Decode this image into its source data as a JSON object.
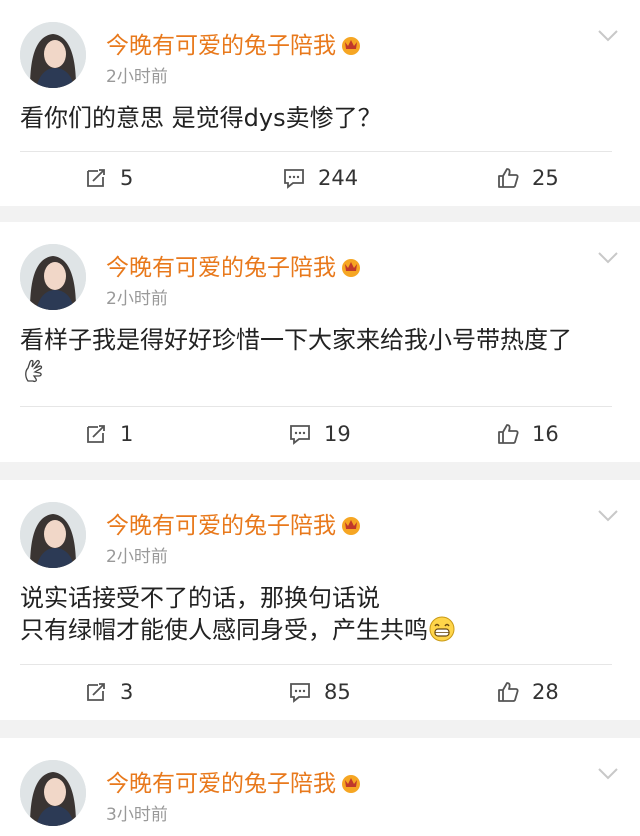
{
  "colors": {
    "username": "#e8791c",
    "timestamp": "#999999",
    "text": "#222222",
    "separator": "#f2f2f2"
  },
  "posts": [
    {
      "username": "今晚有可爱的兔子陪我",
      "time": "2小时前",
      "lines": [
        "看你们的意思 是觉得dys卖惨了？"
      ],
      "reposts": "5",
      "comments": "244",
      "likes": "25"
    },
    {
      "username": "今晚有可爱的兔子陪我",
      "time": "2小时前",
      "lines": [
        "看样子我是得好好珍惜一下大家来给我小号带热度了"
      ],
      "reposts": "1",
      "comments": "19",
      "likes": "16"
    },
    {
      "username": "今晚有可爱的兔子陪我",
      "time": "2小时前",
      "lines": [
        "说实话接受不了的话，那换句话说",
        "只有绿帽才能使人感同身受，产生共鸣"
      ],
      "reposts": "3",
      "comments": "85",
      "likes": "28"
    },
    {
      "username": "今晚有可爱的兔子陪我",
      "time": "3小时前"
    }
  ]
}
